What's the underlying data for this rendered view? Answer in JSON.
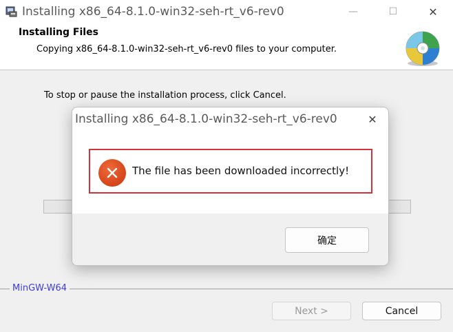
{
  "window": {
    "title": "Installing x86_64-8.1.0-win32-seh-rt_v6-rev0",
    "icon": "installer-icon",
    "minimize_glyph": "—",
    "maximize_glyph": "☐",
    "close_glyph": "✕"
  },
  "header": {
    "title": "Installing Files",
    "subtitle": "Copying x86_64-8.1.0-win32-seh-rt_v6-rev0 files to your computer.",
    "icon": "cd-disc-icon"
  },
  "body": {
    "instruction": "To stop or pause the installation process, click Cancel.",
    "progress": 0
  },
  "footer": {
    "brand": "MinGW-W64",
    "next_label": "Next >",
    "cancel_label": "Cancel"
  },
  "dialog": {
    "title": "Installing x86_64-8.1.0-win32-seh-rt_v6-rev0",
    "close_glyph": "✕",
    "message": "The file has been downloaded incorrectly!",
    "icon": "error-icon",
    "ok_label": "确定"
  },
  "colors": {
    "highlight_border": "#d0343a",
    "error_icon": "#d84a1e",
    "brand_text": "#3c3cd8",
    "window_bg": "#f0f0f0"
  }
}
